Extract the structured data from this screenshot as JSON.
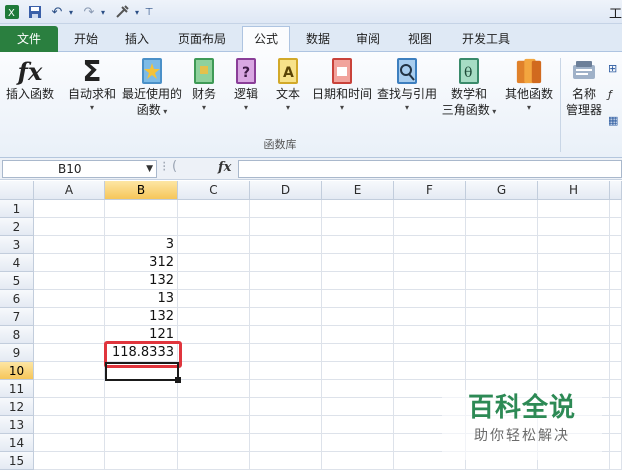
{
  "title_bar": {
    "title": "工"
  },
  "tabs": [
    {
      "label": "文件",
      "kind": "file"
    },
    {
      "label": "开始"
    },
    {
      "label": "插入"
    },
    {
      "label": "页面布局"
    },
    {
      "label": "公式",
      "active": true
    },
    {
      "label": "数据"
    },
    {
      "label": "审阅"
    },
    {
      "label": "视图"
    },
    {
      "label": "开发工具"
    }
  ],
  "ribbon": {
    "group_label": "函数库",
    "buttons": [
      {
        "label": "插入函数",
        "label2": "",
        "caret": false,
        "icon": "fx-icon"
      },
      {
        "label": "自动求和",
        "label2": "",
        "caret": true,
        "icon": "sigma-icon"
      },
      {
        "label": "最近使用的",
        "label2": "函数",
        "caret": true,
        "icon": "star-book-icon"
      },
      {
        "label": "财务",
        "label2": "",
        "caret": true,
        "icon": "finance-book-icon"
      },
      {
        "label": "逻辑",
        "label2": "",
        "caret": true,
        "icon": "logic-book-icon"
      },
      {
        "label": "文本",
        "label2": "",
        "caret": true,
        "icon": "text-book-icon"
      },
      {
        "label": "日期和时间",
        "label2": "",
        "caret": true,
        "icon": "date-book-icon"
      },
      {
        "label": "查找与引用",
        "label2": "",
        "caret": true,
        "icon": "lookup-book-icon"
      },
      {
        "label": "数学和",
        "label2": "三角函数",
        "caret": true,
        "icon": "math-book-icon"
      },
      {
        "label": "其他函数",
        "label2": "",
        "caret": true,
        "icon": "more-books-icon"
      },
      {
        "label": "名称",
        "label2": "管理器",
        "caret": false,
        "icon": "name-manager-icon"
      }
    ]
  },
  "formula_bar": {
    "name_box": "B10",
    "fx": "fx",
    "formula": ""
  },
  "grid": {
    "columns": [
      "A",
      "B",
      "C",
      "D",
      "E",
      "F",
      "G",
      "H"
    ],
    "rows": [
      "1",
      "2",
      "3",
      "4",
      "5",
      "6",
      "7",
      "8",
      "9",
      "10",
      "11",
      "12",
      "13",
      "14",
      "15"
    ],
    "selected_column": "B",
    "selected_row": "10",
    "column_b_values": [
      "",
      "",
      "3",
      "312",
      "132",
      "13",
      "132",
      "121",
      "118.8333",
      "",
      "",
      "",
      "",
      "",
      ""
    ]
  },
  "watermark": {
    "title": "百科全说",
    "subtitle": "助你轻松解决"
  },
  "colors": {
    "file_tab": "#2a7f3f",
    "highlight": "#e0353d",
    "selected_header": "#f6c65a"
  }
}
